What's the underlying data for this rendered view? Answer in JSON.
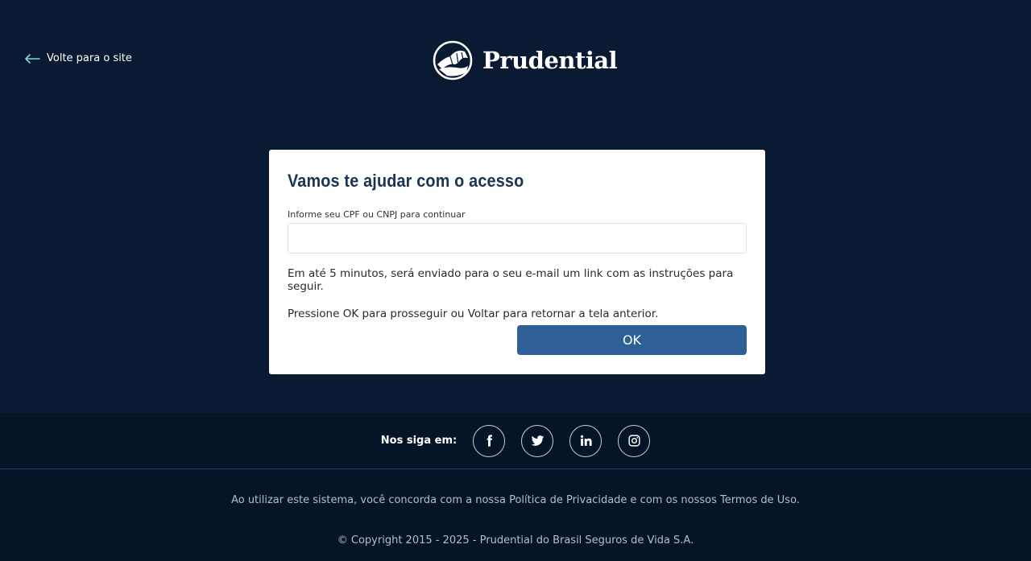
{
  "nav": {
    "back_label": "Volte para o site"
  },
  "brand": {
    "name": "Prudential"
  },
  "card": {
    "title": "Vamos te ajudar com o acesso",
    "field_label": "Informe seu CPF ou CNPJ para continuar",
    "field_value": "",
    "message_1": "Em até 5 minutos, será enviado para o seu e-mail um link com as instruções para seguir.",
    "message_2": "Pressione OK para prosseguir ou Voltar para retornar a tela anterior.",
    "ok_label": "OK"
  },
  "footer": {
    "follow_label": "Nos siga em:",
    "social": [
      "facebook-icon",
      "twitter-icon",
      "linkedin-icon",
      "instagram-icon"
    ],
    "terms": "Ao utilizar este sistema, você concorda com a nossa Política de Privacidade e com os nossos Termos de Uso.",
    "copyright": "© Copyright 2015 - 2025 - Prudential do Brasil Seguros de Vida S.A."
  },
  "colors": {
    "background": "#0a1a33",
    "footer": "#061428",
    "title": "#1a3352",
    "button": "#2f5f97",
    "back_arrow": "#7fd3e8"
  }
}
